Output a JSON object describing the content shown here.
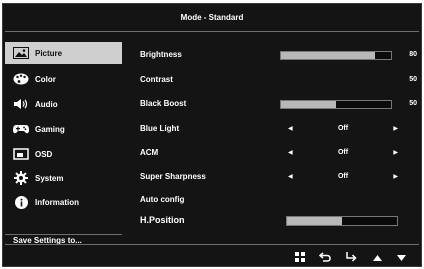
{
  "header": {
    "title": "Mode - Standard"
  },
  "sidebar": {
    "items": [
      {
        "label": "Picture",
        "icon": "picture-icon",
        "active": true
      },
      {
        "label": "Color",
        "icon": "palette-icon",
        "active": false
      },
      {
        "label": "Audio",
        "icon": "speaker-icon",
        "active": false
      },
      {
        "label": "Gaming",
        "icon": "gamepad-icon",
        "active": false
      },
      {
        "label": "OSD",
        "icon": "osd-window-icon",
        "active": false
      },
      {
        "label": "System",
        "icon": "gear-icon",
        "active": false
      },
      {
        "label": "Information",
        "icon": "info-icon",
        "active": false
      }
    ],
    "save_label": "Save Settings to..."
  },
  "settings": {
    "brightness": {
      "label": "Brightness",
      "value": "80",
      "level": 0.85
    },
    "contrast": {
      "label": "Contrast",
      "value": "50"
    },
    "black_boost": {
      "label": "Black Boost",
      "value": "50",
      "level": 0.5
    },
    "blue_light": {
      "label": "Blue Light",
      "value": "Off"
    },
    "acm": {
      "label": "ACM",
      "value": "Off"
    },
    "super_sharpness": {
      "label": "Super Sharpness",
      "value": "Off"
    },
    "auto_config": {
      "label": "Auto config"
    },
    "h_position": {
      "label": "H.Position",
      "level": 0.5
    }
  },
  "nav_buttons": [
    "menu-grid-icon",
    "back-icon",
    "enter-icon",
    "up-arrow-icon",
    "down-arrow-icon"
  ],
  "colors": {
    "background": "#141414",
    "text": "#ffffff",
    "highlight": "#cfcfcf",
    "bar_fill": "#b8b8b8"
  }
}
